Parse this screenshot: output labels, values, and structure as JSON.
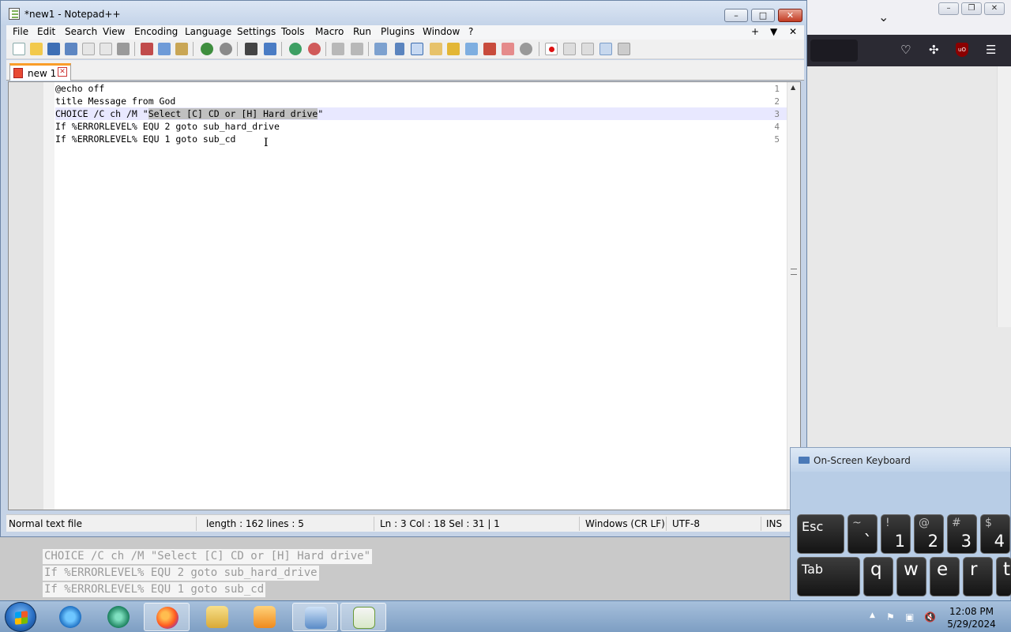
{
  "notepad": {
    "title": "*new1 - Notepad++",
    "menu": [
      "File",
      "Edit",
      "Search",
      "View",
      "Encoding",
      "Language",
      "Settings",
      "Tools",
      "Macro",
      "Run",
      "Plugins",
      "Window",
      "?"
    ],
    "menu_right": [
      "+",
      "▼",
      "✕"
    ],
    "caption_buttons": {
      "minimize": "–",
      "maximize": "□",
      "close": "✕"
    },
    "tab": {
      "label": "new 1",
      "close": "✕"
    },
    "lines": [
      {
        "num": "1",
        "pre": "@echo off",
        "sel": "",
        "post": ""
      },
      {
        "num": "2",
        "pre": "title Message from God",
        "sel": "",
        "post": ""
      },
      {
        "num": "3",
        "pre": "CHOICE /C ch /M \"",
        "sel": "Select [C] CD or [H] Hard drive",
        "post": "\""
      },
      {
        "num": "4",
        "pre": "If %ERRORLEVEL% EQU 2 goto sub_hard_drive",
        "sel": "",
        "post": ""
      },
      {
        "num": "5",
        "pre": "If %ERRORLEVEL% EQU 1 goto sub_cd",
        "sel": "",
        "post": ""
      }
    ],
    "status": {
      "file_type": "Normal text file",
      "length": "length : 162    lines : 5",
      "position": "Ln : 3    Col : 18    Sel : 31 | 1",
      "eol": "Windows (CR LF)",
      "encoding": "UTF-8",
      "mode": "INS"
    }
  },
  "ghost_text": [
    "CHOICE /C ch /M \"Select [C] CD or [H] Hard drive\"",
    "If %ERRORLEVEL% EQU 2 goto sub_hard_drive",
    "If %ERRORLEVEL% EQU 1 goto sub_cd"
  ],
  "browser": {
    "caption": {
      "minimize": "–",
      "restore": "❐",
      "close": "✕"
    },
    "ublock": "uO"
  },
  "osk": {
    "title": "On-Screen Keyboard",
    "row1": [
      {
        "label": "Esc"
      },
      {
        "small": "~",
        "big": "`"
      },
      {
        "small": "!",
        "big": "1"
      },
      {
        "small": "@",
        "big": "2"
      },
      {
        "small": "#",
        "big": "3"
      },
      {
        "small": "$",
        "big": "4"
      }
    ],
    "row2": [
      {
        "label": "Tab"
      },
      {
        "letter": "q"
      },
      {
        "letter": "w"
      },
      {
        "letter": "e"
      },
      {
        "letter": "r"
      },
      {
        "letter": "t"
      }
    ]
  },
  "taskbar": {
    "items": [
      "internet-explorer",
      "chat-app",
      "firefox",
      "file-explorer",
      "media-player",
      "remote-desktop",
      "notepad-plus-plus"
    ],
    "clock_time": "12:08 PM",
    "clock_date": "5/29/2024"
  }
}
